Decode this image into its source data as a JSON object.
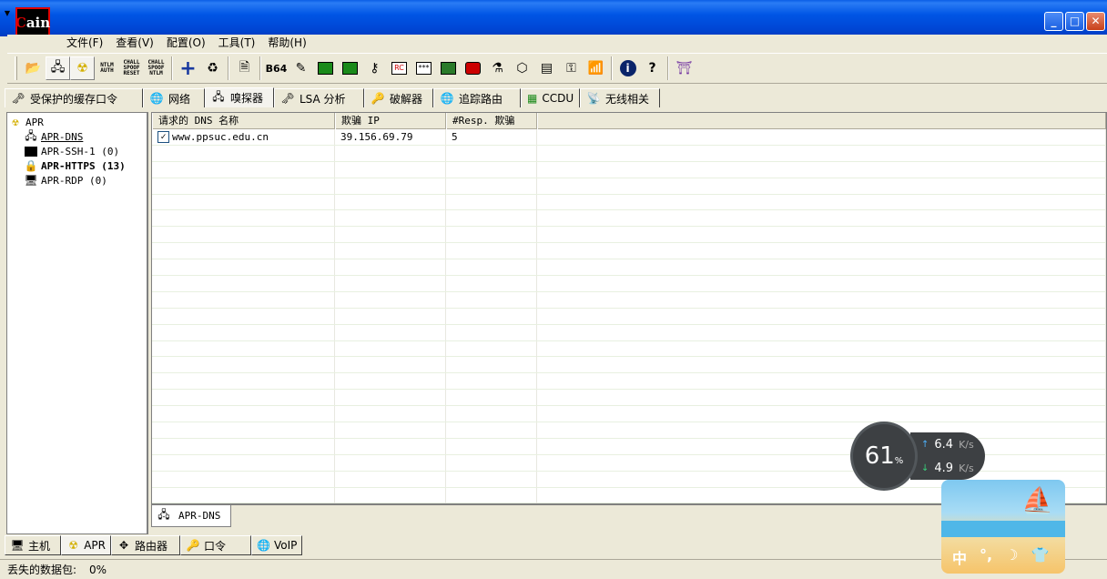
{
  "window": {
    "logo_text": "Cain",
    "buttons": {
      "minimize": "_",
      "maximize": "□",
      "close": "✕"
    }
  },
  "menu": [
    "文件(F)",
    "查看(V)",
    "配置(O)",
    "工具(T)",
    "帮助(H)"
  ],
  "toolbar": {
    "ntlm_auth": "NTLM AUTH",
    "chall_spoof_reset": "CHALL SPOOF RESET",
    "chall_spoof_ntlm": "CHALL SPOOF NTLM",
    "b64": "B64",
    "stars": "***"
  },
  "tabs": [
    "受保护的缓存口令",
    "网络",
    "嗅探器",
    "LSA 分析",
    "破解器",
    "追踪路由",
    "CCDU",
    "无线相关"
  ],
  "tree": {
    "root": "APR",
    "children": [
      {
        "label": "APR-DNS"
      },
      {
        "label": "APR-SSH-1  (0)"
      },
      {
        "label": "APR-HTTPS  (13)"
      },
      {
        "label": "APR-RDP  (0)"
      }
    ]
  },
  "grid": {
    "columns": [
      "请求的 DNS 名称",
      "欺骗 IP",
      "#Resp. 欺骗"
    ],
    "rows": [
      {
        "name": "www.ppsuc.edu.cn",
        "ip": "39.156.69.79",
        "resp": "5",
        "checked": "☑"
      }
    ]
  },
  "subtab": "APR-DNS",
  "bottom_tabs": [
    "主机",
    "APR",
    "路由器",
    "口令",
    "VoIP"
  ],
  "status": {
    "label": "丢失的数据包:",
    "value": "0%"
  },
  "net_widget": {
    "percent": "61",
    "pct_sign": "%",
    "up_speed": "6.4",
    "down_speed": "4.9",
    "unit": "K/s"
  },
  "ime": {
    "lang": "中",
    "punct": "°,",
    "moon": "☽",
    "shirt": "👕"
  }
}
